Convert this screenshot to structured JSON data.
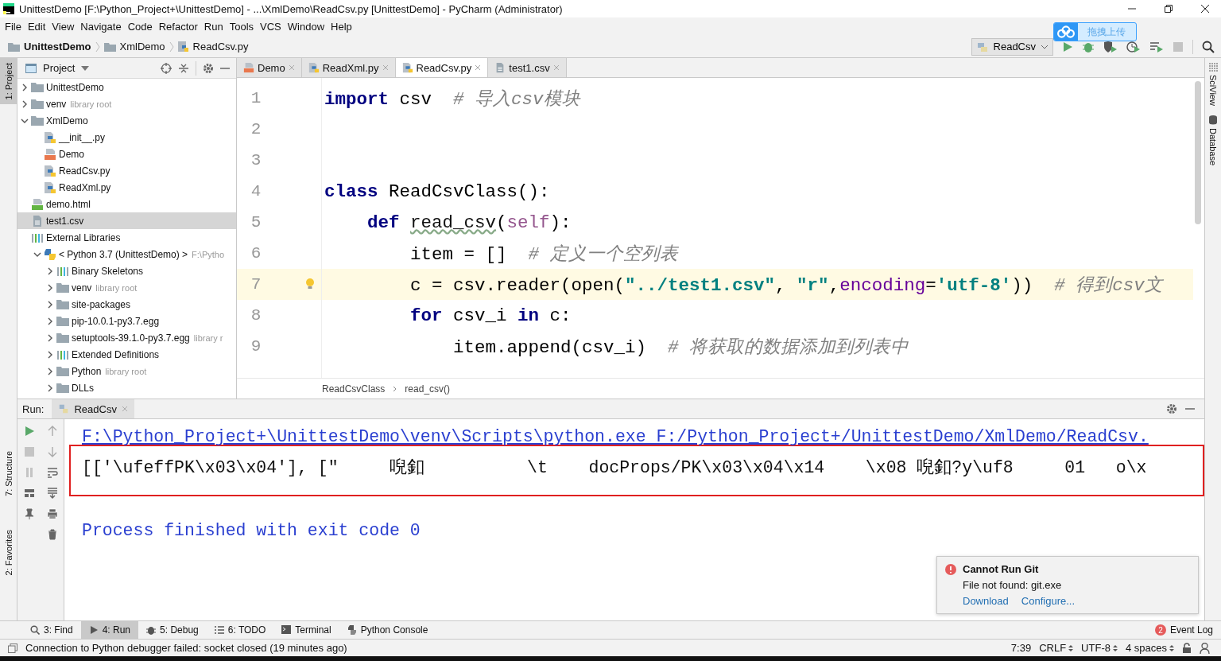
{
  "window": {
    "title": "UnittestDemo [F:\\Python_Project+\\UnittestDemo] - ...\\XmlDemo\\ReadCsv.py [UnittestDemo] - PyCharm (Administrator)"
  },
  "menu": [
    "File",
    "Edit",
    "View",
    "Navigate",
    "Code",
    "Refactor",
    "Run",
    "Tools",
    "VCS",
    "Window",
    "Help"
  ],
  "breadcrumb": [
    {
      "label": "UnittestDemo",
      "kind": "folder"
    },
    {
      "label": "XmlDemo",
      "kind": "folder"
    },
    {
      "label": "ReadCsv.py",
      "kind": "python"
    }
  ],
  "run_config": {
    "label": "ReadCsv"
  },
  "upload_widget": {
    "label": "拖拽上传"
  },
  "side_stripes": {
    "left": [
      {
        "label": "1: Project",
        "kind": "project",
        "selected": true
      },
      {
        "label": "7: Structure",
        "kind": "structure",
        "selected": false
      },
      {
        "label": "2: Favorites",
        "kind": "favorites",
        "selected": false
      }
    ],
    "right": [
      {
        "label": "SciView",
        "kind": "sciview"
      },
      {
        "label": "Database",
        "kind": "database"
      }
    ]
  },
  "project_panel": {
    "title": "Project",
    "tree": [
      {
        "label": "UnittestDemo",
        "kind": "folder",
        "expanded": false,
        "selected": false
      },
      {
        "label": "venv",
        "suffix": "library root",
        "kind": "folder",
        "expanded": false,
        "selected": false
      },
      {
        "label": "XmlDemo",
        "kind": "folder",
        "expanded": true,
        "selected": false,
        "children": [
          {
            "label": "__init__.py",
            "kind": "python",
            "selected": false
          },
          {
            "label": "Demo",
            "kind": "xml",
            "selected": false
          },
          {
            "label": "ReadCsv.py",
            "kind": "python",
            "selected": false
          },
          {
            "label": "ReadXml.py",
            "kind": "python",
            "selected": false
          }
        ]
      },
      {
        "label": "demo.html",
        "kind": "html",
        "selected": false
      },
      {
        "label": "test1.csv",
        "kind": "csv",
        "selected": true
      },
      {
        "label": "External Libraries",
        "kind": "libraries",
        "selected": false,
        "children": [
          {
            "label": "< Python 3.7 (UnittestDemo) >",
            "suffix": "F:\\Pytho",
            "kind": "sdk",
            "expanded": true,
            "selected": false,
            "children": [
              {
                "label": "Binary Skeletons",
                "kind": "libraries",
                "expanded": false,
                "selected": false
              },
              {
                "label": "venv",
                "suffix": "library root",
                "kind": "folder",
                "expanded": false,
                "selected": false
              },
              {
                "label": "site-packages",
                "kind": "folder",
                "expanded": false,
                "selected": false
              },
              {
                "label": "pip-10.0.1-py3.7.egg",
                "kind": "folder",
                "expanded": false,
                "selected": false
              },
              {
                "label": "setuptools-39.1.0-py3.7.egg",
                "suffix": "library r",
                "kind": "folder",
                "expanded": false,
                "selected": false
              },
              {
                "label": "Extended Definitions",
                "kind": "libraries",
                "expanded": false,
                "selected": false
              },
              {
                "label": "Python",
                "suffix": "library root",
                "kind": "folder",
                "expanded": false,
                "selected": false
              },
              {
                "label": "DLLs",
                "kind": "folder",
                "expanded": false,
                "selected": false
              }
            ]
          }
        ]
      }
    ]
  },
  "editor": {
    "tabs": [
      {
        "label": "Demo",
        "kind": "xml",
        "selected": false
      },
      {
        "label": "ReadXml.py",
        "kind": "python",
        "selected": false
      },
      {
        "label": "ReadCsv.py",
        "kind": "python",
        "selected": true
      },
      {
        "label": "test1.csv",
        "kind": "csv",
        "selected": false
      }
    ],
    "lines": [
      {
        "number": "1",
        "current": false,
        "segments": [
          {
            "kind": "keyword",
            "text": "import"
          },
          {
            "kind": "plain",
            "text": " csv  "
          },
          {
            "kind": "comment",
            "text": "# 导入csv模块"
          }
        ]
      },
      {
        "number": "2",
        "current": false
      },
      {
        "number": "3",
        "current": false
      },
      {
        "number": "4",
        "current": false,
        "segments": [
          {
            "kind": "keyword",
            "text": "class"
          },
          {
            "kind": "plain",
            "text": " ReadCsvClass():"
          }
        ]
      },
      {
        "number": "5",
        "current": false,
        "segments": [
          {
            "kind": "keyword",
            "text": "    def "
          },
          {
            "kind": "warned",
            "text": "read_csv"
          },
          {
            "kind": "plain",
            "text": "("
          },
          {
            "kind": "self",
            "text": "self"
          },
          {
            "kind": "plain",
            "text": "):"
          }
        ]
      },
      {
        "number": "6",
        "current": false,
        "segments": [
          {
            "kind": "plain",
            "text": "        item = []  "
          },
          {
            "kind": "comment",
            "text": "# 定义一个空列表"
          }
        ]
      },
      {
        "number": "7",
        "current": true,
        "segments": [
          {
            "kind": "plain",
            "text": "        c = csv.reader(open("
          },
          {
            "kind": "string",
            "text": "\"../test1.csv\""
          },
          {
            "kind": "plain",
            "text": ", "
          },
          {
            "kind": "string",
            "text": "\"r\""
          },
          {
            "kind": "plain",
            "text": ","
          },
          {
            "kind": "param",
            "text": "encoding"
          },
          {
            "kind": "plain",
            "text": "="
          },
          {
            "kind": "string",
            "text": "'utf-8'"
          },
          {
            "kind": "plain",
            "text": "))  "
          },
          {
            "kind": "comment",
            "text": "# 得到csv文"
          }
        ]
      },
      {
        "number": "8",
        "current": false,
        "segments": [
          {
            "kind": "keyword",
            "text": "        for"
          },
          {
            "kind": "plain",
            "text": " csv_i "
          },
          {
            "kind": "keyword",
            "text": "in"
          },
          {
            "kind": "plain",
            "text": " c:"
          }
        ]
      },
      {
        "number": "9",
        "current": false,
        "segments": [
          {
            "kind": "plain",
            "text": "            item.append(csv_i)  "
          },
          {
            "kind": "comment",
            "text": "# 将获取的数据添加到列表中"
          }
        ]
      }
    ],
    "breadcrumb": [
      "ReadCsvClass",
      "read_csv()"
    ]
  },
  "run_panel": {
    "label": "Run:",
    "tab": "ReadCsv",
    "output": [
      {
        "kind": "command",
        "highlighted": false,
        "text": "F:\\Python_Project+\\UnittestDemo\\venv\\Scripts\\python.exe F:/Python_Project+/UnittestDemo/XmlDemo/ReadCsv."
      },
      {
        "kind": "data",
        "highlighted": true,
        "text": "[['\\ufeffPK\\x03\\x04'], [\"     唲釦          \\t    docProps/PK\\x03\\x04\\x14    \\x08 唲釦?y\\uf8     01   o\\x"
      },
      {
        "kind": "exit",
        "highlighted": false,
        "text": "Process finished with exit code 0"
      }
    ]
  },
  "notification": {
    "title": "Cannot Run Git",
    "message": "File not found: git.exe",
    "links": [
      "Download",
      "Configure..."
    ]
  },
  "tool_windows": [
    {
      "label": "3: Find",
      "kind": "find",
      "selected": false
    },
    {
      "label": "4: Run",
      "kind": "run",
      "selected": true
    },
    {
      "label": "5: Debug",
      "kind": "debug",
      "selected": false
    },
    {
      "label": "6: TODO",
      "kind": "todo",
      "selected": false
    },
    {
      "label": "Terminal",
      "kind": "terminal",
      "selected": false
    },
    {
      "label": "Python Console",
      "kind": "console",
      "selected": false
    }
  ],
  "event_log": {
    "label": "Event Log",
    "count": "2"
  },
  "status_bar": {
    "message": "Connection to Python debugger failed: socket closed (19 minutes ago)",
    "position": "7:39",
    "line_separator": "CRLF",
    "encoding": "UTF-8",
    "indent": "4 spaces"
  }
}
